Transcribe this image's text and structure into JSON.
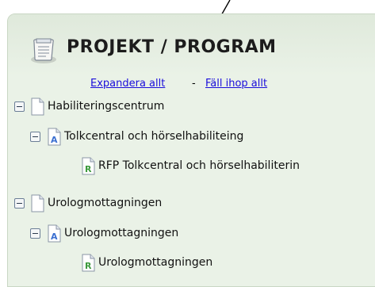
{
  "header": {
    "title": "PROJEKT / PROGRAM",
    "icon": "document-icon"
  },
  "links": {
    "expand_all": "Expandera allt",
    "separator": "-",
    "collapse_all": "Fäll ihop allt"
  },
  "tree": [
    {
      "label": "Habiliteringscentrum",
      "icon": "page-icon",
      "level": 1,
      "toggle": "minus"
    },
    {
      "label": "Tolkcentral och hörselhabiliteing",
      "icon": "a-document-icon",
      "level": 2,
      "toggle": "minus"
    },
    {
      "label": "RFP Tolkcentral och hörselhabiliterin",
      "icon": "r-document-icon",
      "level": 3,
      "toggle": "none"
    },
    {
      "label": "Urologmottagningen",
      "icon": "page-icon",
      "level": 1,
      "toggle": "minus"
    },
    {
      "label": "Urologmottagningen",
      "icon": "a-document-icon",
      "level": 2,
      "toggle": "minus"
    },
    {
      "label": "Urologmottagningen",
      "icon": "r-document-icon",
      "level": 3,
      "toggle": "none"
    }
  ],
  "colors": {
    "panel_bg": "#eaf2e7",
    "link": "#1a0ddb",
    "a_icon": "#3b6fd1",
    "r_icon": "#3c9a3c"
  }
}
